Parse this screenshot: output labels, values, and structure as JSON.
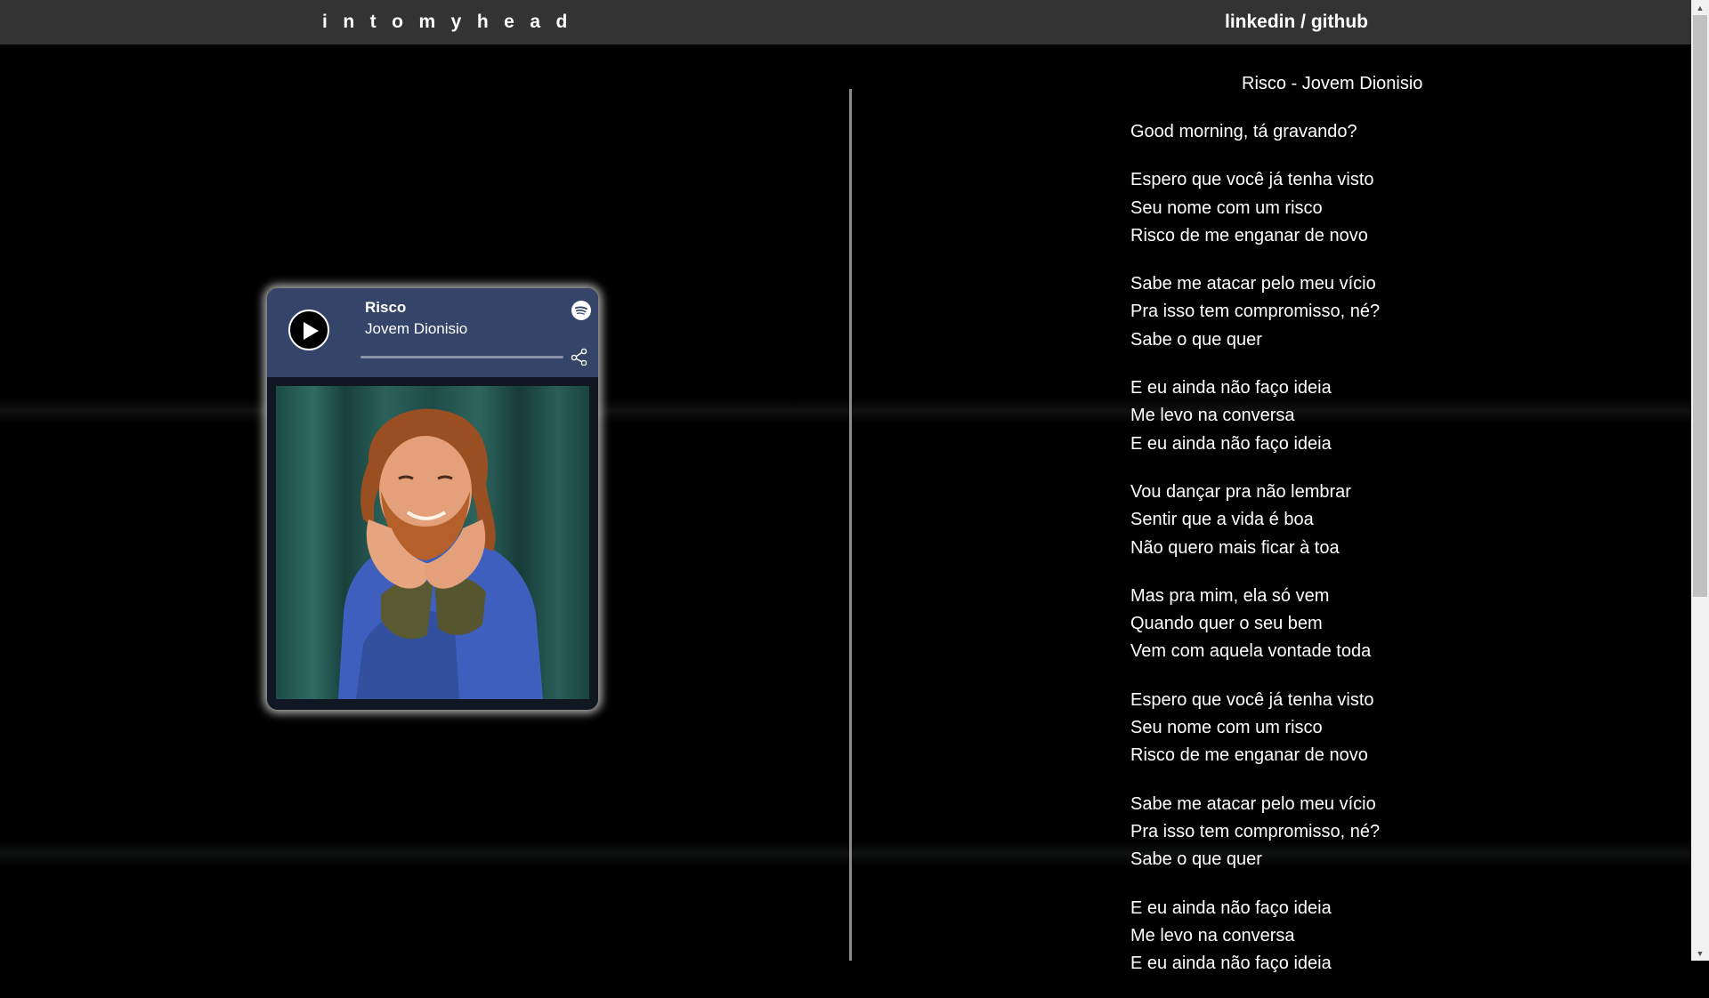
{
  "nav": {
    "brand": "intomyhead",
    "links": "linkedin / github"
  },
  "player": {
    "title": "Risco",
    "artist": "Jovem Dionisio",
    "progress": 0.0,
    "cover_alt": "Album cover photo of artist",
    "icons": {
      "play": "play-icon",
      "service": "spotify-icon",
      "share": "share-icon"
    }
  },
  "lyrics": {
    "heading": "Risco - Jovem Dionisio",
    "stanzas": [
      [
        "Good morning, tá gravando?"
      ],
      [
        "Espero que você já tenha visto",
        "Seu nome com um risco",
        "Risco de me enganar de novo"
      ],
      [
        "Sabe me atacar pelo meu vício",
        "Pra isso tem compromisso, né?",
        "Sabe o que quer"
      ],
      [
        "E eu ainda não faço ideia",
        "Me levo na conversa",
        "E eu ainda não faço ideia"
      ],
      [
        "Vou dançar pra não lembrar",
        "Sentir que a vida é boa",
        "Não quero mais ficar à toa"
      ],
      [
        "Mas pra mim, ela só vem",
        "Quando quer o seu bem",
        "Vem com aquela vontade toda"
      ],
      [
        "Espero que você já tenha visto",
        "Seu nome com um risco",
        "Risco de me enganar de novo"
      ],
      [
        "Sabe me atacar pelo meu vício",
        "Pra isso tem compromisso, né?",
        "Sabe o que quer"
      ],
      [
        "E eu ainda não faço ideia",
        "Me levo na conversa",
        "E eu ainda não faço ideia"
      ]
    ]
  },
  "colors": {
    "navbar": "#333333",
    "background": "#000000",
    "player_header": "#35456a",
    "divider": "#8a8a8a"
  }
}
